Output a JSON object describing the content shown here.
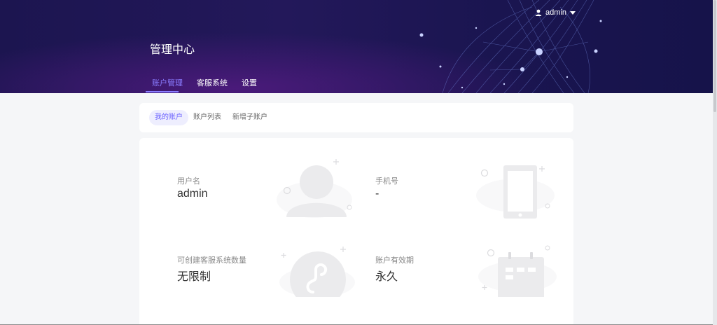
{
  "header": {
    "title": "管理中心",
    "user": {
      "name": "admin",
      "icon": "person-icon",
      "caret": "caret-down-icon"
    },
    "nav": [
      {
        "label": "账户管理",
        "active": true
      },
      {
        "label": "客服系统",
        "active": false
      },
      {
        "label": "设置",
        "active": false
      }
    ]
  },
  "subnav": {
    "tabs": [
      {
        "label": "我的账户",
        "active": true
      },
      {
        "label": "账户列表",
        "active": false
      },
      {
        "label": "新增子账户",
        "active": false
      }
    ]
  },
  "account": {
    "username_label": "用户名",
    "username_value": "admin",
    "phone_label": "手机号",
    "phone_value": "-",
    "quota_label": "可创建客服系统数量",
    "quota_value": "无限制",
    "expiry_label": "账户有效期",
    "expiry_value": "永久"
  },
  "colors": {
    "accent": "#6c63ff",
    "header_bg": "#1c1550"
  }
}
